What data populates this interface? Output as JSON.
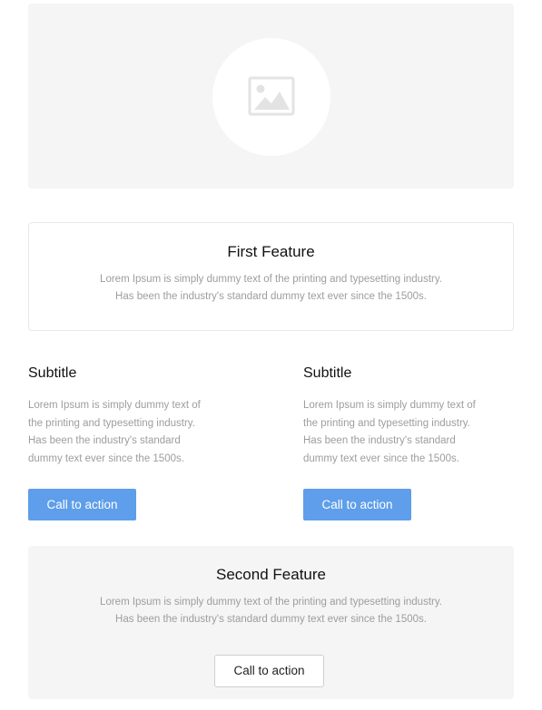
{
  "hero": {
    "icon": "image-placeholder-icon"
  },
  "first_feature": {
    "title": "First Feature",
    "line1": "Lorem Ipsum is simply dummy text of the printing and typesetting industry.",
    "line2": "Has been the industry's standard dummy text ever since the 1500s."
  },
  "columns": [
    {
      "subtitle": "Subtitle",
      "lines": [
        "Lorem Ipsum is simply dummy text of",
        "the printing and typesetting industry.",
        "Has been the industry's standard",
        "dummy text ever since the 1500s."
      ],
      "cta_label": "Call to action"
    },
    {
      "subtitle": "Subtitle",
      "lines": [
        "Lorem Ipsum is simply dummy text of",
        "the printing and typesetting industry.",
        "Has been the industry's standard",
        "dummy text ever since the 1500s."
      ],
      "cta_label": "Call to action"
    }
  ],
  "second_feature": {
    "title": "Second Feature",
    "line1": "Lorem Ipsum is simply dummy text of the printing and typesetting industry.",
    "line2": "Has been the industry's standard dummy text ever since the 1500s.",
    "cta_label": "Call to action"
  },
  "colors": {
    "accent": "#5e9eea",
    "panel": "#f5f5f5",
    "muted_text": "#9d9d9d"
  }
}
